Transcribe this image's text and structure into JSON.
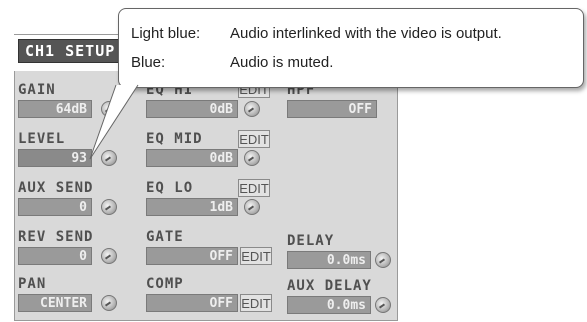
{
  "panel": {
    "title": "CH1 SETUP",
    "gain": {
      "label": "GAIN",
      "value": "64dB"
    },
    "level": {
      "label": "LEVEL",
      "value": "93"
    },
    "aux_send": {
      "label": "AUX SEND",
      "value": "0"
    },
    "rev_send": {
      "label": "REV SEND",
      "value": "0"
    },
    "pan": {
      "label": "PAN",
      "value": "CENTER"
    },
    "eq_hi": {
      "label": "EQ HI",
      "value": "0dB",
      "edit": "EDIT"
    },
    "eq_mid": {
      "label": "EQ MID",
      "value": "0dB",
      "edit": "EDIT"
    },
    "eq_lo": {
      "label": "EQ LO",
      "value": "1dB",
      "edit": "EDIT"
    },
    "gate": {
      "label": "GATE",
      "value": "OFF",
      "edit": "EDIT"
    },
    "comp": {
      "label": "COMP",
      "value": "OFF",
      "edit": "EDIT"
    },
    "hpf": {
      "label": "HPF",
      "value": "OFF"
    },
    "delay": {
      "label": "DELAY",
      "value": "0.0ms"
    },
    "aux_delay": {
      "label": "AUX DELAY",
      "value": "0.0ms"
    }
  },
  "callout": {
    "rows": [
      {
        "key": "Light blue:",
        "desc": "Audio interlinked with the video is output."
      },
      {
        "key": "Blue:",
        "desc": "Audio is muted."
      }
    ]
  },
  "icons": {
    "knob": "knob-icon"
  }
}
